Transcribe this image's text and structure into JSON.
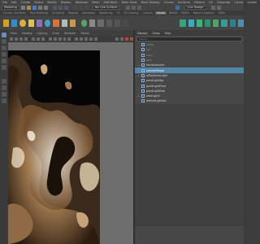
{
  "menubar": {
    "items": [
      "File",
      "Edit",
      "Create",
      "Select",
      "Modify",
      "Display",
      "Windows",
      "Mesh",
      "Edit Mesh",
      "Mesh Tools",
      "Mesh Display",
      "Curves",
      "Surfaces",
      "Deform",
      "UV",
      "Generate",
      "Cache",
      "Arnold",
      "Help"
    ]
  },
  "statusline": {
    "mode": "Modeling",
    "no_live_surface": "No Live Surface",
    "workspace": "Live Design"
  },
  "shelf": {
    "tabs": [
      "Curves / Surfaces",
      "Poly Modeling",
      "Sculpting",
      "Rigging",
      "Animation",
      "Rendering",
      "FX",
      "FX Caching",
      "Custom",
      "Arnold",
      "Bifrost",
      "MASH",
      "Motion Graphics",
      "XGen"
    ],
    "active_tab": "Arnold"
  },
  "viewport": {
    "menus": [
      "View",
      "Shading",
      "Lighting",
      "Show",
      "Renderer",
      "Panels"
    ]
  },
  "outliner": {
    "tabs": [
      "Display",
      "Show",
      "Help"
    ],
    "search_placeholder": "Search...",
    "rows": [
      {
        "label": "persp",
        "dim": true,
        "selected": false,
        "expand": ""
      },
      {
        "label": "top",
        "dim": true,
        "selected": false,
        "expand": ""
      },
      {
        "label": "front",
        "dim": true,
        "selected": false,
        "expand": ""
      },
      {
        "label": "side",
        "dim": true,
        "selected": false,
        "expand": ""
      },
      {
        "label": "fractalVolume",
        "dim": false,
        "selected": false,
        "expand": "+"
      },
      {
        "label": "volumeShape",
        "dim": false,
        "selected": true,
        "expand": ""
      },
      {
        "label": "aiSkyDomeLight",
        "dim": false,
        "selected": false,
        "expand": "+"
      },
      {
        "label": "pointLightTop",
        "dim": false,
        "selected": false,
        "expand": ""
      },
      {
        "label": "pointLightFront",
        "dim": false,
        "selected": false,
        "expand": ""
      },
      {
        "label": "pointLightSide",
        "dim": false,
        "selected": false,
        "expand": ""
      },
      {
        "label": "areaLight1",
        "dim": false,
        "selected": false,
        "expand": "+"
      },
      {
        "label": "defaultLightSet",
        "dim": false,
        "selected": false,
        "expand": ""
      }
    ]
  },
  "colors": {
    "selection": "#5285a6",
    "panel": "#474747",
    "render_bg": "#050505"
  }
}
